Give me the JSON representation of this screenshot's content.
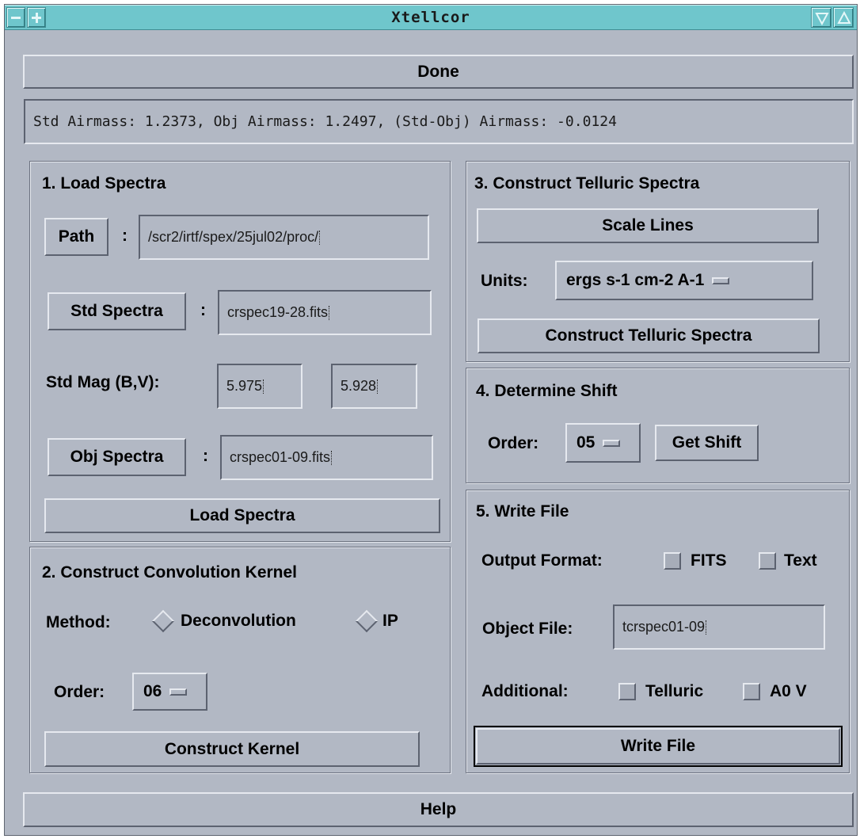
{
  "window": {
    "title": "Xtellcor"
  },
  "top": {
    "done_label": "Done",
    "status": "Std Airmass: 1.2373, Obj Airmass: 1.2497, (Std-Obj) Airmass: -0.0124"
  },
  "load": {
    "title": "1. Load Spectra",
    "path_button": "Path",
    "path_value": "/scr2/irtf/spex/25jul02/proc/",
    "std_button": "Std Spectra",
    "std_value": "crspec19-28.fits",
    "stdmag_label": "Std Mag (B,V):",
    "mag_b": "5.975",
    "mag_v": "5.928",
    "obj_button": "Obj Spectra",
    "obj_value": "crspec01-09.fits",
    "colon": ":",
    "load_button": "Load Spectra"
  },
  "kernel": {
    "title": "2. Construct Convolution Kernel",
    "method_label": "Method:",
    "method_options": [
      "Deconvolution",
      "IP"
    ],
    "order_label": "Order:",
    "order_value": "06",
    "construct_button": "Construct Kernel"
  },
  "telluric": {
    "title": "3. Construct Telluric Spectra",
    "scale_button": "Scale Lines",
    "units_label": "Units:",
    "units_value": "ergs s-1 cm-2 A-1",
    "construct_button": "Construct Telluric Spectra"
  },
  "shift": {
    "title": "4. Determine Shift",
    "order_label": "Order:",
    "order_value": "05",
    "get_button": "Get Shift"
  },
  "write": {
    "title": "5. Write File",
    "format_label": "Output Format:",
    "format_options": [
      "FITS",
      "Text"
    ],
    "object_label": "Object File:",
    "object_value": "tcrspec01-09",
    "additional_label": "Additional:",
    "additional_options": [
      "Telluric",
      "A0 V"
    ],
    "write_button": "Write File"
  },
  "bottom": {
    "help_label": "Help"
  }
}
